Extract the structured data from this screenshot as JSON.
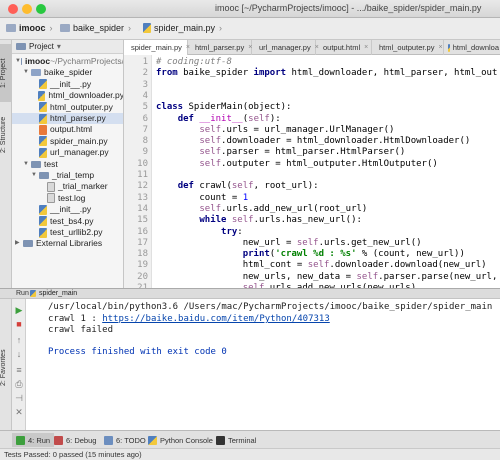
{
  "window": {
    "title": "imooc [~/PycharmProjects/imooc] - .../baike_spider/spider_main.py"
  },
  "breadcrumb": [
    "imooc",
    "baike_spider",
    "spider_main.py"
  ],
  "left_tool_tabs": [
    "1: Project",
    "2: Structure"
  ],
  "project_panel": {
    "header": "Project",
    "tree": [
      {
        "label": "imooc",
        "suffix": " ~/PycharmProjects/",
        "kind": "folder",
        "level": 0,
        "expanded": true
      },
      {
        "label": "baike_spider",
        "kind": "package",
        "level": 1,
        "expanded": true
      },
      {
        "label": "__init__.py",
        "kind": "py",
        "level": 2
      },
      {
        "label": "html_downloader.py",
        "kind": "py",
        "level": 2
      },
      {
        "label": "html_outputer.py",
        "kind": "py",
        "level": 2
      },
      {
        "label": "html_parser.py",
        "kind": "py",
        "level": 2,
        "selected": true
      },
      {
        "label": "output.html",
        "kind": "html",
        "level": 2
      },
      {
        "label": "spider_main.py",
        "kind": "py",
        "level": 2
      },
      {
        "label": "url_manager.py",
        "kind": "py",
        "level": 2
      },
      {
        "label": "test",
        "kind": "folder",
        "level": 1,
        "expanded": true
      },
      {
        "label": "_trial_temp",
        "kind": "folder",
        "level": 2,
        "expanded": true
      },
      {
        "label": "_trial_marker",
        "kind": "generic",
        "level": 3
      },
      {
        "label": "test.log",
        "kind": "generic",
        "level": 3
      },
      {
        "label": "__init__.py",
        "kind": "py",
        "level": 2
      },
      {
        "label": "test_bs4.py",
        "kind": "py",
        "level": 2
      },
      {
        "label": "test_urllib2.py",
        "kind": "py",
        "level": 2
      },
      {
        "label": "External Libraries",
        "kind": "lib",
        "level": 0
      }
    ]
  },
  "editor_tabs": [
    {
      "label": "spider_main.py",
      "kind": "py",
      "active": true
    },
    {
      "label": "html_parser.py",
      "kind": "py"
    },
    {
      "label": "url_manager.py",
      "kind": "py"
    },
    {
      "label": "output.html",
      "kind": "html"
    },
    {
      "label": "html_outputer.py",
      "kind": "py"
    },
    {
      "label": "html_downloa",
      "kind": "py"
    }
  ],
  "code_lines": [
    [
      [
        "cm",
        "# coding:utf-8"
      ]
    ],
    [
      [
        "kw",
        "from "
      ],
      [
        "fn",
        "baike_spider "
      ],
      [
        "kw",
        "import "
      ],
      [
        "fn",
        "html_downloader, html_parser, html_out"
      ]
    ],
    [],
    [],
    [
      [
        "kw",
        "class "
      ],
      [
        "fn",
        "SpiderMain("
      ],
      [
        "fn",
        "object"
      ],
      [
        "fn",
        "):"
      ]
    ],
    [
      [
        "fn",
        "    "
      ],
      [
        "kw",
        "def "
      ],
      [
        "df",
        "__init__"
      ],
      [
        "fn",
        "("
      ],
      [
        "sf",
        "self"
      ],
      [
        "fn",
        "):"
      ]
    ],
    [
      [
        "fn",
        "        "
      ],
      [
        "sf",
        "self"
      ],
      [
        "fn",
        ".urls = url_manager.UrlManager()"
      ]
    ],
    [
      [
        "fn",
        "        "
      ],
      [
        "sf",
        "self"
      ],
      [
        "fn",
        ".downloader = html_downloader.HtmlDownloader()"
      ]
    ],
    [
      [
        "fn",
        "        "
      ],
      [
        "sf",
        "self"
      ],
      [
        "fn",
        ".parser = html_parser.HtmlParser()"
      ]
    ],
    [
      [
        "fn",
        "        "
      ],
      [
        "sf",
        "self"
      ],
      [
        "fn",
        ".outputer = html_outputer.HtmlOutputer()"
      ]
    ],
    [],
    [
      [
        "fn",
        "    "
      ],
      [
        "kw",
        "def "
      ],
      [
        "fn",
        "crawl("
      ],
      [
        "sf",
        "self"
      ],
      [
        "fn",
        ", root_url):"
      ]
    ],
    [
      [
        "fn",
        "        count = "
      ],
      [
        "nm",
        "1"
      ]
    ],
    [
      [
        "fn",
        "        "
      ],
      [
        "sf",
        "self"
      ],
      [
        "fn",
        ".urls.add_new_url(root_url)"
      ]
    ],
    [
      [
        "fn",
        "        "
      ],
      [
        "kw",
        "while "
      ],
      [
        "sf",
        "self"
      ],
      [
        "fn",
        ".urls.has_new_url():"
      ]
    ],
    [
      [
        "fn",
        "            "
      ],
      [
        "kw",
        "try"
      ],
      [
        "fn",
        ":"
      ]
    ],
    [
      [
        "fn",
        "                new_url = "
      ],
      [
        "sf",
        "self"
      ],
      [
        "fn",
        ".urls.get_new_url()"
      ]
    ],
    [
      [
        "fn",
        "                "
      ],
      [
        "kw",
        "print"
      ],
      [
        "fn",
        "("
      ],
      [
        "st",
        "'crawl %d : %s'"
      ],
      [
        "fn",
        " % (count, new_url))"
      ]
    ],
    [
      [
        "fn",
        "                html_cont = "
      ],
      [
        "sf",
        "self"
      ],
      [
        "fn",
        ".downloader.download(new_url)"
      ]
    ],
    [
      [
        "fn",
        "                new_urls, new_data = "
      ],
      [
        "sf",
        "self"
      ],
      [
        "fn",
        ".parser.parse(new_url, h"
      ]
    ],
    [
      [
        "fn",
        "                "
      ],
      [
        "sf",
        "self"
      ],
      [
        "fn",
        ".urls.add_new_urls(new_urls)"
      ]
    ],
    [
      [
        "fn",
        "                "
      ],
      [
        "sf",
        "self"
      ],
      [
        "fn",
        ".outputer.collect_data(new_data)"
      ]
    ]
  ],
  "run_panel": {
    "label": "Run",
    "config": "spider_main",
    "console": {
      "command": "/usr/local/bin/python3.6 /Users/mac/PycharmProjects/imooc/baike_spider/spider_main",
      "crawl_prefix": "crawl 1 : ",
      "crawl_url": "https://baike.baidu.com/item/Python/407313",
      "failed": "crawl failed",
      "finished": "Process finished with exit code 0"
    },
    "left_vertical_tab": "2: Favorites"
  },
  "bottom_tabs": [
    {
      "label": "4: Run",
      "active": true
    },
    {
      "label": "6: Debug"
    },
    {
      "label": "6: TODO"
    },
    {
      "label": "Python Console"
    },
    {
      "label": "Terminal"
    }
  ],
  "status": "Tests Passed: 0 passed (15 minutes ago)",
  "colors": {
    "accent": "#4a90d9",
    "selection": "#d4dff0",
    "run_green": "#3d9f3d",
    "stop_red": "#d43f3a"
  }
}
